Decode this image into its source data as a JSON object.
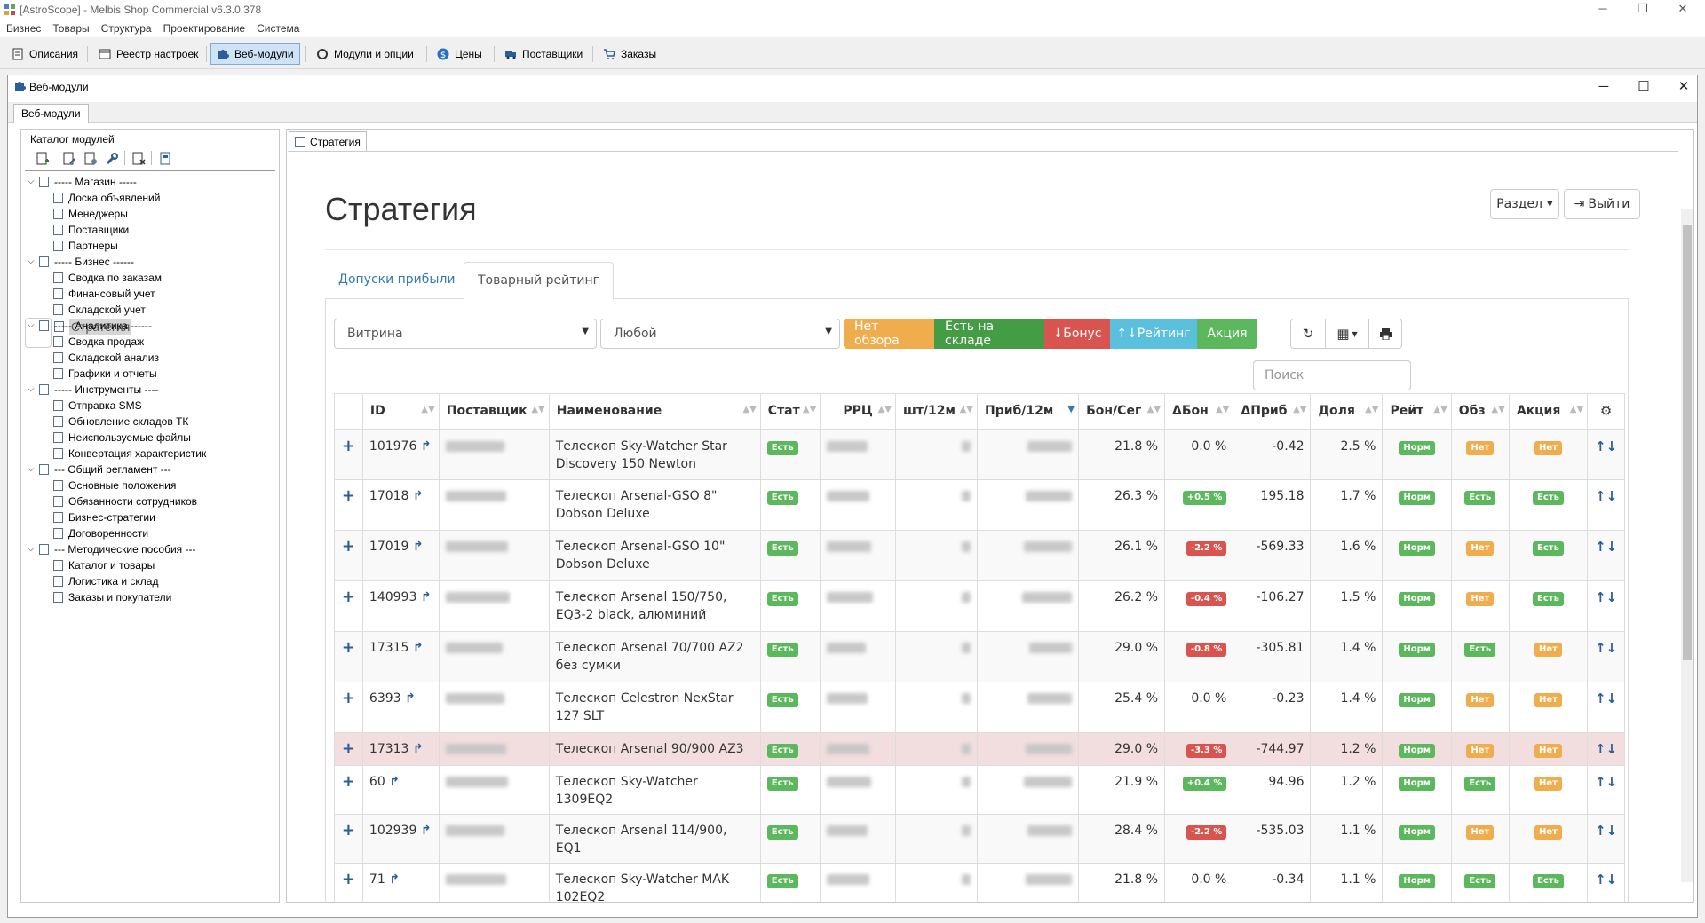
{
  "window": {
    "title": "[AstroScope] - Melbis Shop Commercial v6.3.0.378",
    "minimize": "─",
    "restore": "❐",
    "close": "✕"
  },
  "menu": [
    "Бизнес",
    "Товары",
    "Структура",
    "Проектирование",
    "Система"
  ],
  "toolbar": [
    "Описания",
    "Реестр настроек",
    "Веб-модули",
    "Модули и опции",
    "Цены",
    "Поставщики",
    "Заказы"
  ],
  "child": {
    "title": "Веб-модули",
    "tab": "Веб-модули"
  },
  "catalog": {
    "header": "Каталог модулей",
    "tree": [
      {
        "label": "----- Магазин -----",
        "level": 0
      },
      {
        "label": "Доска объявлений",
        "level": 1
      },
      {
        "label": "Менеджеры",
        "level": 1
      },
      {
        "label": "Поставщики",
        "level": 1
      },
      {
        "label": "Партнеры",
        "level": 1
      },
      {
        "label": "----- Бизнес ------",
        "level": 0
      },
      {
        "label": "Сводка по заказам",
        "level": 1
      },
      {
        "label": "Финансовый учет",
        "level": 1
      },
      {
        "label": "Складской учет",
        "level": 1
      },
      {
        "label": "Стратегия",
        "level": 1,
        "selected": true
      },
      {
        "label": "----- Аналитика ------",
        "level": 0
      },
      {
        "label": "Сводка продаж",
        "level": 1
      },
      {
        "label": "Складской анализ",
        "level": 1
      },
      {
        "label": "Графики и отчеты",
        "level": 1
      },
      {
        "label": "----- Инструменты ----",
        "level": 0
      },
      {
        "label": "Отправка SMS",
        "level": 1
      },
      {
        "label": "Обновление складов ТК",
        "level": 1
      },
      {
        "label": "Неиспользуемые файлы",
        "level": 1
      },
      {
        "label": "Конвертация характеристик",
        "level": 1
      },
      {
        "label": "--- Общий регламент ---",
        "level": 0
      },
      {
        "label": "Основные положения",
        "level": 1
      },
      {
        "label": "Обязанности сотрудников",
        "level": 1
      },
      {
        "label": "Бизнес-стратегии",
        "level": 1
      },
      {
        "label": "Договоренности",
        "level": 1
      },
      {
        "label": "--- Методические пособия ---",
        "level": 0
      },
      {
        "label": "Каталог и товары",
        "level": 1
      },
      {
        "label": "Логистика и склад",
        "level": 1
      },
      {
        "label": "Заказы и покупатели",
        "level": 1
      }
    ]
  },
  "content_tab": "Стратегия",
  "page": {
    "title": "Стратегия",
    "section_btn": "Раздел",
    "exit_btn": "Выйти",
    "tabs": [
      "Допуски прибыли",
      "Товарный рейтинг"
    ],
    "select1": "Витрина",
    "select2": "Любой",
    "filters": [
      {
        "label": "Нет обзора",
        "color": "#f0ad4e"
      },
      {
        "label": "Есть на складе",
        "color": "#449d44"
      },
      {
        "label": "↓Бонус",
        "color": "#d9534f"
      },
      {
        "label": "↑↓Рейтинг",
        "color": "#5bc0de"
      },
      {
        "label": "Акция",
        "color": "#5cb85c"
      }
    ],
    "search_placeholder": "Поиск",
    "columns": [
      "ID",
      "Поставщик",
      "Наименование",
      "Стат",
      "РРЦ",
      "шт/12м",
      "Приб/12м",
      "Бон/Сег",
      "ΔБон",
      "ΔПриб",
      "Доля",
      "Рейт",
      "Обз",
      "Акция"
    ]
  },
  "rows": [
    {
      "id": "101976",
      "name": "Телескоп Sky-Watcher Star Discovery 150 Newton",
      "stat": "Есть",
      "bon": "21.8 %",
      "dbon": "0.0 %",
      "dbon_c": "",
      "dprib": "-0.42",
      "share": "2.5 %",
      "rate": "Норм",
      "obz": "Нет",
      "akc": "Нет"
    },
    {
      "id": "17018",
      "name": "Телескоп Arsenal-GSO 8\" Dobson Deluxe",
      "stat": "Есть",
      "bon": "26.3 %",
      "dbon": "+0.5 %",
      "dbon_c": "g",
      "dprib": "195.18",
      "share": "1.7 %",
      "rate": "Норм",
      "obz": "Есть",
      "akc": "Есть"
    },
    {
      "id": "17019",
      "name": "Телескоп Arsenal-GSO 10\" Dobson Deluxe",
      "stat": "Есть",
      "bon": "26.1 %",
      "dbon": "-2.2 %",
      "dbon_c": "r",
      "dprib": "-569.33",
      "share": "1.6 %",
      "rate": "Норм",
      "obz": "Нет",
      "akc": "Есть"
    },
    {
      "id": "140993",
      "name": "Телескоп Arsenal 150/750, EQ3-2 black, алюминий",
      "stat": "Есть",
      "bon": "26.2 %",
      "dbon": "-0.4 %",
      "dbon_c": "r",
      "dprib": "-106.27",
      "share": "1.5 %",
      "rate": "Норм",
      "obz": "Нет",
      "akc": "Есть"
    },
    {
      "id": "17315",
      "name": "Телескоп Arsenal 70/700 AZ2 без сумки",
      "stat": "Есть",
      "bon": "29.0 %",
      "dbon": "-0.8 %",
      "dbon_c": "r",
      "dprib": "-305.81",
      "share": "1.4 %",
      "rate": "Норм",
      "obz": "Есть",
      "akc": "Нет"
    },
    {
      "id": "6393",
      "name": "Телескоп Celestron NexStar 127 SLT",
      "stat": "Есть",
      "bon": "25.4 %",
      "dbon": "0.0 %",
      "dbon_c": "",
      "dprib": "-0.23",
      "share": "1.4 %",
      "rate": "Норм",
      "obz": "Нет",
      "akc": "Нет"
    },
    {
      "id": "17313",
      "name": "Телескоп Arsenal 90/900 AZ3",
      "stat": "Есть",
      "bon": "29.0 %",
      "dbon": "-3.3 %",
      "dbon_c": "r",
      "dprib": "-744.97",
      "share": "1.2 %",
      "rate": "Норм",
      "obz": "Нет",
      "akc": "Нет"
    },
    {
      "id": "60",
      "name": "Телескоп Sky-Watcher 1309EQ2",
      "stat": "Есть",
      "bon": "21.9 %",
      "dbon": "+0.4 %",
      "dbon_c": "g",
      "dprib": "94.96",
      "share": "1.2 %",
      "rate": "Норм",
      "obz": "Есть",
      "akc": "Нет"
    },
    {
      "id": "102939",
      "name": "Телескоп Arsenal 114/900, EQ1",
      "stat": "Есть",
      "bon": "28.4 %",
      "dbon": "-2.2 %",
      "dbon_c": "r",
      "dprib": "-535.03",
      "share": "1.1 %",
      "rate": "Норм",
      "obz": "Нет",
      "akc": "Нет"
    },
    {
      "id": "71",
      "name": "Телескоп Sky-Watcher MAK 102EQ2",
      "stat": "Есть",
      "bon": "21.8 %",
      "dbon": "0.0 %",
      "dbon_c": "",
      "dprib": "-0.34",
      "share": "1.1 %",
      "rate": "Норм",
      "obz": "Есть",
      "akc": "Есть"
    }
  ]
}
